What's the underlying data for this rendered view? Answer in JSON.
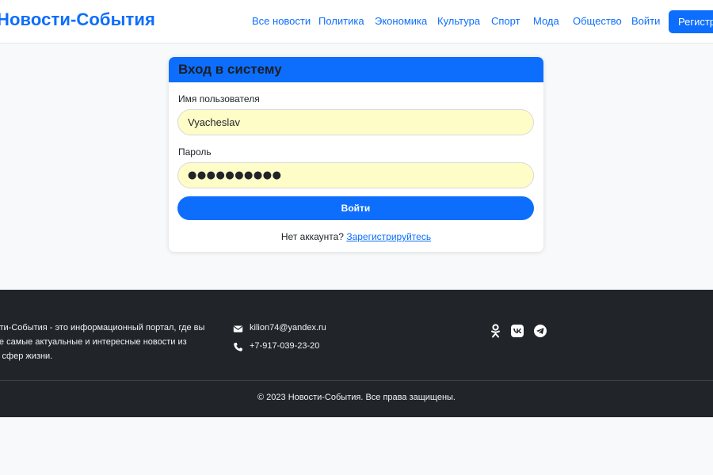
{
  "brand": "Новости-События",
  "nav": {
    "items": [
      "Все новости",
      "Политика",
      "Экономика",
      "Культура",
      "Спорт",
      "Мода",
      "Общество",
      "Войти"
    ],
    "register_label": "Регистрация"
  },
  "login": {
    "title": "Вход в систему",
    "username_label": "Имя пользователя",
    "username_value": "Vyacheslav",
    "password_label": "Пароль",
    "password_mask": "●●●●●●●●●●",
    "submit_label": "Войти",
    "no_account_text": "Нет аккаунта?",
    "signup_link": "Зарегистрируйтесь"
  },
  "footer": {
    "about_lines": [
      "сти-События - это информационный портал, где вы",
      "те самые актуальные и интересные новости из",
      "х сфер жизни."
    ],
    "email": "kilion74@yandex.ru",
    "phone": "+7-917-039-23-20",
    "social_icons": [
      "odnoklassniki-icon",
      "vk-icon",
      "telegram-icon"
    ],
    "copyright": "© 2023 Новости-События. Все права защищены."
  },
  "colors": {
    "primary": "#0d6efd",
    "input_autofill": "#fefcc7",
    "footer_bg": "#212529",
    "page_bg": "#f8f9fa"
  }
}
